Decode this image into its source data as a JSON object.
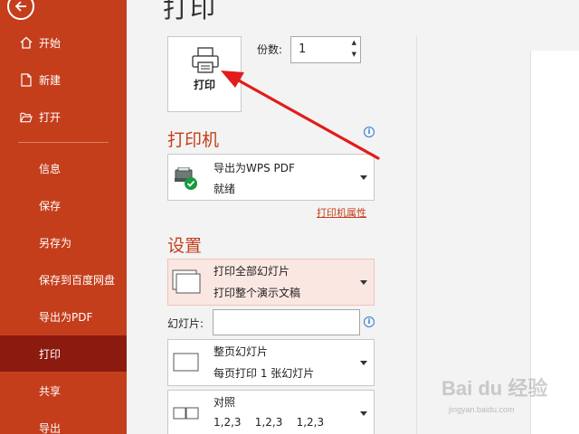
{
  "sidebar": {
    "items": [
      {
        "label": "开始",
        "icon": "home-icon"
      },
      {
        "label": "新建",
        "icon": "new-file-icon"
      },
      {
        "label": "打开",
        "icon": "folder-open-icon"
      },
      {
        "label": "信息"
      },
      {
        "label": "保存"
      },
      {
        "label": "另存为"
      },
      {
        "label": "保存到百度网盘"
      },
      {
        "label": "导出为PDF"
      },
      {
        "label": "打印",
        "active": true
      },
      {
        "label": "共享"
      },
      {
        "label": "导出"
      }
    ]
  },
  "main": {
    "title": "打印",
    "print_button_label": "打印",
    "copies_label": "份数:",
    "copies_value": "1",
    "printer_section_title": "打印机",
    "printer": {
      "name": "导出为WPS PDF",
      "status": "就绪"
    },
    "printer_properties_link": "打印机属性",
    "settings_section_title": "设置",
    "settings": [
      {
        "line1": "打印全部幻灯片",
        "line2": "打印整个演示文稿"
      },
      {
        "line1": "整页幻灯片",
        "line2": "每页打印 1 张幻灯片"
      },
      {
        "line1": "对照",
        "line2": "1,2,3    1,2,3    1,2,3"
      }
    ],
    "slides_label": "幻灯片:",
    "slides_value": ""
  },
  "watermark": {
    "logo": "Bai du 经验",
    "url": "jingyan.baidu.com"
  },
  "colors": {
    "accent": "#c43e1c",
    "active_item": "#8b1a0f",
    "info": "#2b7cd3",
    "annotation_arrow": "#e31b1b"
  }
}
